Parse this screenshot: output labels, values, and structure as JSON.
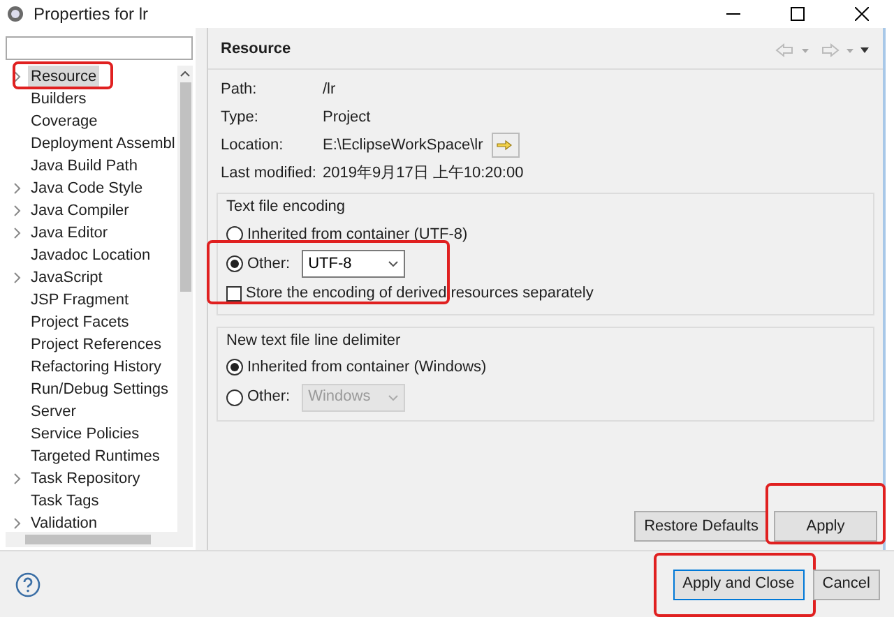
{
  "window": {
    "title": "Properties for lr"
  },
  "tree": [
    {
      "label": "Resource",
      "expandable": true,
      "selected": true,
      "highlighted": true
    },
    {
      "label": "Builders",
      "expandable": false,
      "selected": false,
      "highlighted": false
    },
    {
      "label": "Coverage",
      "expandable": false,
      "selected": false,
      "highlighted": false
    },
    {
      "label": "Deployment Assembl",
      "expandable": false,
      "selected": false,
      "highlighted": false
    },
    {
      "label": "Java Build Path",
      "expandable": false,
      "selected": false,
      "highlighted": false
    },
    {
      "label": "Java Code Style",
      "expandable": true,
      "selected": false,
      "highlighted": false
    },
    {
      "label": "Java Compiler",
      "expandable": true,
      "selected": false,
      "highlighted": false
    },
    {
      "label": "Java Editor",
      "expandable": true,
      "selected": false,
      "highlighted": false
    },
    {
      "label": "Javadoc Location",
      "expandable": false,
      "selected": false,
      "highlighted": false
    },
    {
      "label": "JavaScript",
      "expandable": true,
      "selected": false,
      "highlighted": false
    },
    {
      "label": "JSP Fragment",
      "expandable": false,
      "selected": false,
      "highlighted": false
    },
    {
      "label": "Project Facets",
      "expandable": false,
      "selected": false,
      "highlighted": false
    },
    {
      "label": "Project References",
      "expandable": false,
      "selected": false,
      "highlighted": false
    },
    {
      "label": "Refactoring History",
      "expandable": false,
      "selected": false,
      "highlighted": false
    },
    {
      "label": "Run/Debug Settings",
      "expandable": false,
      "selected": false,
      "highlighted": false
    },
    {
      "label": "Server",
      "expandable": false,
      "selected": false,
      "highlighted": false
    },
    {
      "label": "Service Policies",
      "expandable": false,
      "selected": false,
      "highlighted": false
    },
    {
      "label": "Targeted Runtimes",
      "expandable": false,
      "selected": false,
      "highlighted": false
    },
    {
      "label": "Task Repository",
      "expandable": true,
      "selected": false,
      "highlighted": false
    },
    {
      "label": "Task Tags",
      "expandable": false,
      "selected": false,
      "highlighted": false
    },
    {
      "label": "Validation",
      "expandable": true,
      "selected": false,
      "highlighted": false
    }
  ],
  "page": {
    "title": "Resource",
    "info": [
      {
        "label": "Path:",
        "value": "/lr"
      },
      {
        "label": "Type:",
        "value": "Project"
      },
      {
        "label": "Location:",
        "value": "E:\\EclipseWorkSpace\\lr"
      },
      {
        "label": "Last modified:",
        "value": "2019年9月17日 上午10:20:00"
      }
    ],
    "encoding": {
      "title": "Text file encoding",
      "inherited": {
        "label": "Inherited from container (UTF-8)",
        "selected": false
      },
      "other": {
        "label": "Other:",
        "selected": true,
        "value": "UTF-8",
        "disabled": false
      },
      "highlighted": true,
      "derived": {
        "label": "Store the encoding of derived resources separately",
        "checked": false
      }
    },
    "delimiter": {
      "title": "New text file line delimiter",
      "inherited": {
        "label": "Inherited from container (Windows)",
        "selected": true
      },
      "other": {
        "label": "Other:",
        "selected": false,
        "value": "Windows",
        "disabled": true
      }
    },
    "buttons": [
      {
        "label": "Restore Defaults",
        "highlighted": false
      },
      {
        "label": "Apply",
        "highlighted": true
      }
    ]
  },
  "footer_buttons": [
    {
      "label": "Apply and Close",
      "highlighted": true,
      "default": true
    },
    {
      "label": "Cancel",
      "highlighted": false,
      "default": false
    }
  ]
}
